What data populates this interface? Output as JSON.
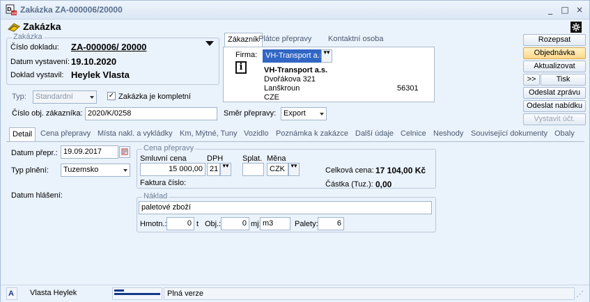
{
  "window": {
    "title": "Zakázka ZA-000006/20000",
    "min": "_",
    "max": "□",
    "close": "×"
  },
  "header": {
    "title": "Zakázka"
  },
  "zakazka": {
    "legend": "Zakázka",
    "cislo_label": "Číslo dokladu:",
    "cislo_value": "ZA-000006/ 20000",
    "datum_label": "Datum vystavení:",
    "datum_value": "19.10.2020",
    "vystavil_label": "Doklad vystavil:",
    "vystavil_value": "Heylek Vlasta"
  },
  "typ": {
    "label": "Typ:",
    "value": "Standardní"
  },
  "kompletni": {
    "label": "Zakázka je kompletní",
    "checked": true
  },
  "cislo_obj": {
    "label": "Číslo obj. zákazníka:",
    "value": "2020/K/0258"
  },
  "smer": {
    "label": "Směr přepravy:",
    "value": "Export"
  },
  "customer_tabs": [
    "Zákazník",
    "Plátce přepravy",
    "Kontaktní osoba"
  ],
  "customer": {
    "firma_label": "Firma:",
    "firma_value": "VH-Transport a.s.",
    "name": "VH-Transport a.s.",
    "street": "Dvořákova 321",
    "city": "Lanškroun",
    "zip": "56301",
    "country": "CZE"
  },
  "side_buttons": [
    "Rozepsat",
    "Objednávka",
    "Aktualizovat",
    ">>",
    "Tisk",
    "Odeslat zprávu",
    "Odeslat nabídku",
    "Vystavit účt."
  ],
  "main_tabs": [
    "Detail",
    "Cena přepravy",
    "Místa nakl. a vykládky",
    "Km, Mýtné, Tuny",
    "Vozidlo",
    "Poznámka k zakázce",
    "Další údaje",
    "Celnice",
    "Neshody",
    "Související dokumenty",
    "Obaly"
  ],
  "detail": {
    "datum_prepr_label": "Datum přepr.:",
    "datum_prepr_value": "19.09.2017",
    "typ_plneni_label": "Typ plnění:",
    "typ_plneni_value": "Tuzemsko",
    "datum_hlaseni_label": "Datum hlášení:"
  },
  "cena": {
    "legend": "Cena přepravy",
    "smluvni_label": "Smluvní cena",
    "smluvni_value": "15 000,00",
    "dph_label": "DPH",
    "dph_value": "21",
    "splat_label": "Splat.",
    "splat_value": "",
    "mena_label": "Měna",
    "mena_value": "CZK",
    "faktura_label": "Faktura číslo:",
    "celkova_label": "Celková cena:",
    "celkova_value": "17 104,00 Kč",
    "castka_label": "Částka (Tuz.):",
    "castka_value": "0,00"
  },
  "naklad": {
    "legend": "Náklad",
    "popis": "paletové zboží",
    "hmotn_label": "Hmotn.:",
    "hmotn_value": "0",
    "hmotn_unit": "t",
    "obj_label": "Obj.:",
    "obj_value": "0",
    "mj_label": "mj:",
    "mj_value": "m3",
    "palety_label": "Palety:",
    "palety_value": "6"
  },
  "status": {
    "badge": "A",
    "user": "Vlasta Heylek",
    "version": "Plná verze"
  },
  "colors": {
    "accent": "#3166c4",
    "active_button": "#ffd78a",
    "background": "#eaf2fb"
  }
}
